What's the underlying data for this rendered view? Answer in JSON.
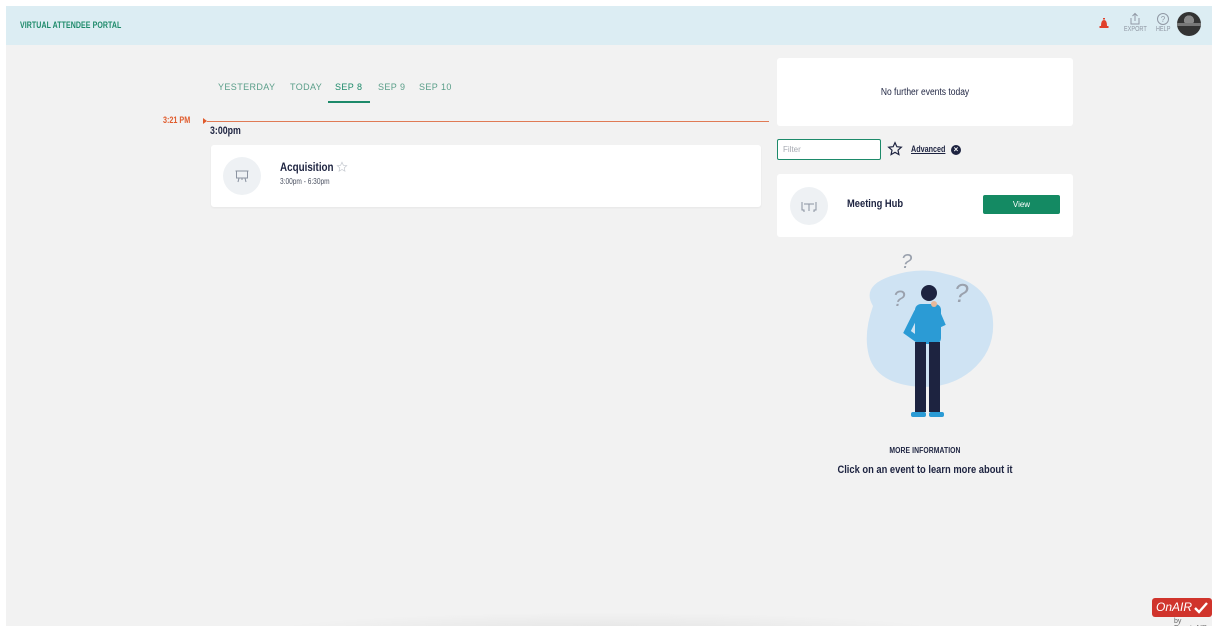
{
  "header": {
    "brand": "VIRTUAL ATTENDEE PORTAL",
    "export_label": "EXPORT",
    "help_label": "HELP",
    "colors": {
      "bar": "#dcedf3",
      "brand": "#1d8a6a",
      "alert": "#e0402b"
    },
    "icons": [
      "alert-icon",
      "export-icon",
      "help-icon",
      "avatar"
    ]
  },
  "tabs": [
    {
      "label": "YESTERDAY",
      "active": false
    },
    {
      "label": "TODAY",
      "active": false
    },
    {
      "label": "SEP 8",
      "active": true
    },
    {
      "label": "SEP 9",
      "active": false
    },
    {
      "label": "SEP 10",
      "active": false
    }
  ],
  "timeline": {
    "now_label": "3:21 PM",
    "hour_label": "3:00pm"
  },
  "event": {
    "title": "Acquisition",
    "time": "3:00pm - 6:30pm",
    "icon": "presentation-icon"
  },
  "sidebar": {
    "no_events": "No further events today",
    "filter_placeholder": "Filter",
    "advanced_label": "Advanced",
    "hub": {
      "label": "Meeting Hub",
      "button": "View",
      "icon": "meeting-table-icon"
    },
    "more_info_title": "MORE INFORMATION",
    "more_info_text": "Click on an event to learn more about it"
  },
  "footer": {
    "logo_text": "OnAIR",
    "logo_sub": "by EventsAIR"
  }
}
